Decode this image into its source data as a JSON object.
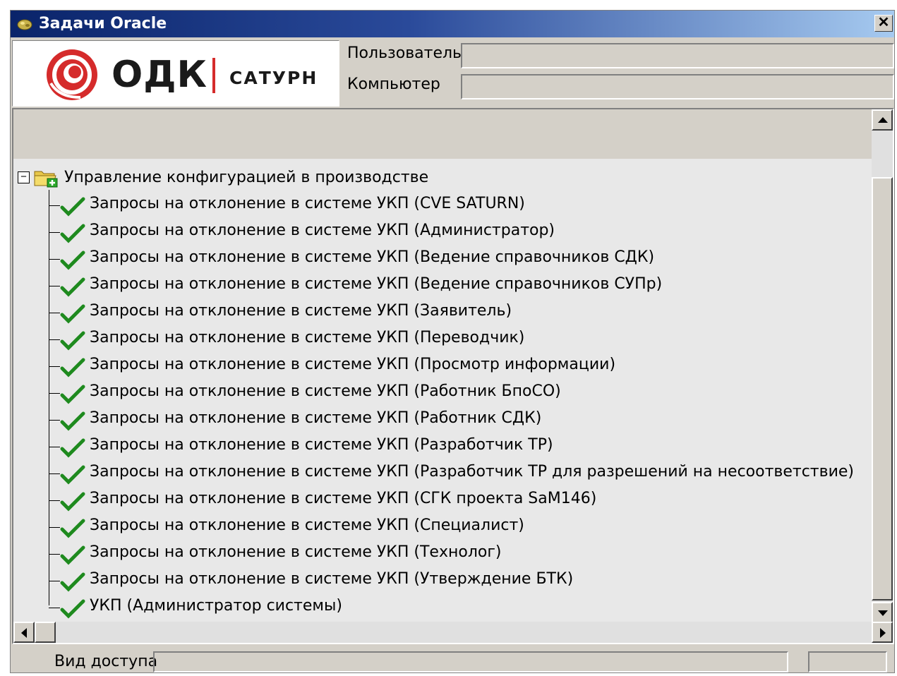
{
  "window": {
    "title": "Задачи Oracle",
    "close_label": "✕"
  },
  "logo": {
    "main_text": "ОДК",
    "sub_text": "САТУРН"
  },
  "fields": {
    "user_label": "Пользователь",
    "user_value": "",
    "computer_label": "Компьютер",
    "computer_value": ""
  },
  "tree": {
    "root": {
      "label": "Управление конфигурацией в производстве",
      "expander": "−"
    },
    "items": [
      {
        "label": "Запросы на отклонение в системе УКП (CVE SATURN)"
      },
      {
        "label": "Запросы на отклонение в системе УКП (Администратор)"
      },
      {
        "label": "Запросы на отклонение в системе УКП (Ведение справочников СДК)"
      },
      {
        "label": "Запросы на отклонение в системе УКП (Ведение справочников СУПр)"
      },
      {
        "label": "Запросы на отклонение в системе УКП (Заявитель)"
      },
      {
        "label": "Запросы на отклонение в системе УКП (Переводчик)"
      },
      {
        "label": "Запросы на отклонение в системе УКП (Просмотр информации)"
      },
      {
        "label": "Запросы на отклонение в системе УКП (Работник БпоСО)"
      },
      {
        "label": "Запросы на отклонение в системе УКП (Работник СДК)"
      },
      {
        "label": "Запросы на отклонение в системе УКП (Разработчик ТР)"
      },
      {
        "label": "Запросы на отклонение в системе УКП (Разработчик ТР для разрешений на несоответствие)"
      },
      {
        "label": "Запросы на отклонение в системе УКП (СГК проекта SaM146)"
      },
      {
        "label": "Запросы на отклонение в системе УКП (Специалист)"
      },
      {
        "label": "Запросы на отклонение в системе УКП (Технолог)"
      },
      {
        "label": "Запросы на отклонение в системе УКП (Утверждение БТК)"
      },
      {
        "label": "УКП (Администратор системы)"
      }
    ]
  },
  "status": {
    "access_label": "Вид доступа",
    "access_value": ""
  },
  "colors": {
    "titlebar_start": "#0a246a",
    "titlebar_end": "#a6caf0",
    "brand_red": "#d52b2b",
    "check_green": "#1e8a1e"
  },
  "icons": {
    "app": "oracle-tasks-icon",
    "folder": "folder-plus-icon",
    "item": "green-check-icon"
  }
}
